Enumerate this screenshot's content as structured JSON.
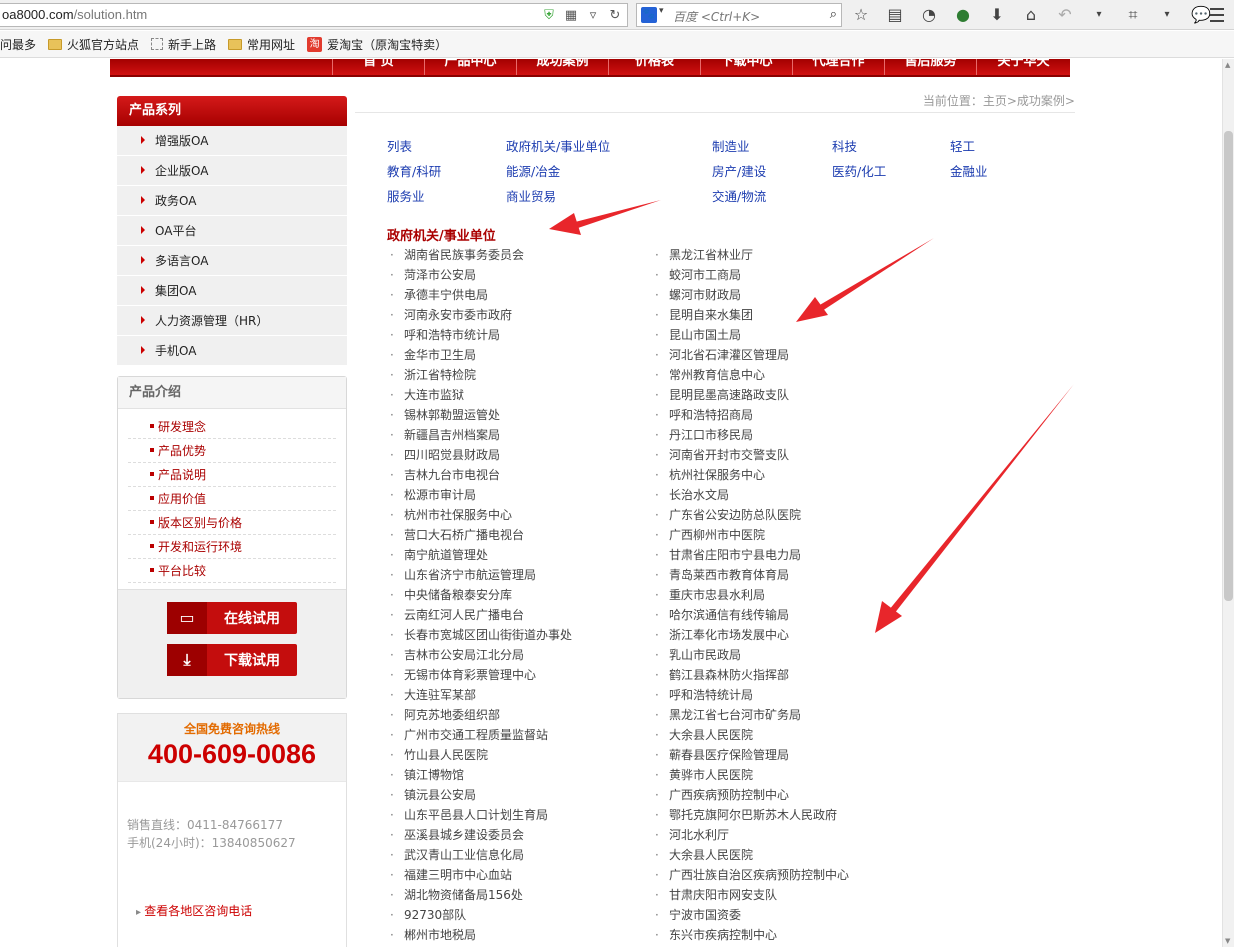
{
  "browser": {
    "url_host": "oa8000.com",
    "url_path": "/solution.htm",
    "search_placeholder": "百度 <Ctrl+K>",
    "search_engine_glyph": "🐾",
    "bookmarks": [
      {
        "label": "问最多",
        "type": "text"
      },
      {
        "label": "火狐官方站点",
        "type": "folder"
      },
      {
        "label": "新手上路",
        "type": "dashed"
      },
      {
        "label": "常用网址",
        "type": "folder"
      },
      {
        "label": "爱淘宝（原淘宝特卖）",
        "type": "taobao",
        "glyph": "淘"
      }
    ]
  },
  "nav": {
    "items": [
      "首 页",
      "产品中心",
      "成功案例",
      "价格表",
      "下载中心",
      "代理合作",
      "售后服务",
      "关于华天"
    ]
  },
  "sidebar": {
    "series_title": "产品系列",
    "products": [
      "增强版OA",
      "企业版OA",
      "政务OA",
      "OA平台",
      "多语言OA",
      "集团OA",
      "人力资源管理（HR）",
      "手机OA"
    ],
    "intro_title": "产品介绍",
    "intro_items": [
      "研发理念",
      "产品优势",
      "产品说明",
      "应用价值",
      "版本区别与价格",
      "开发和运行环境",
      "平台比较"
    ],
    "online_trial": "在线试用",
    "download_trial": "下载试用",
    "hotline_label": "全国免费咨询热线",
    "hotline_number": "400-609-0086",
    "sales_line": "销售直线：0411-84766177",
    "mobile_line": "手机(24小时)：13840850627",
    "region_link": "查看各地区咨询电话"
  },
  "content": {
    "breadcrumb": "当前位置：主页>成功案例>",
    "categories": [
      [
        "列表",
        "政府机关/事业单位",
        "制造业",
        "科技",
        "轻工"
      ],
      [
        "教育/科研",
        "能源/冶金",
        "房产/建设",
        "医药/化工",
        "金融业"
      ],
      [
        "服务业",
        "商业贸易",
        "交通/物流"
      ]
    ],
    "section_title": "政府机关/事业单位",
    "orgs_left": [
      "湖南省民族事务委员会",
      "菏泽市公安局",
      "承德丰宁供电局",
      "河南永安市委市政府",
      "呼和浩特市统计局",
      "金华市卫生局",
      "浙江省特检院",
      "大连市监狱",
      "锡林郭勒盟运管处",
      "新疆昌吉州档案局",
      "四川昭觉县财政局",
      "吉林九台市电视台",
      "松源市审计局",
      "杭州市社保服务中心",
      "营口大石桥广播电视台",
      "南宁航道管理处",
      "山东省济宁市航运管理局",
      "中央储备粮泰安分库",
      "云南红河人民广播电台",
      "长春市宽城区团山街街道办事处",
      "吉林市公安局江北分局",
      "无锡市体育彩票管理中心",
      "大连驻军某部",
      "阿克苏地委组织部",
      "广州市交通工程质量监督站",
      "竹山县人民医院",
      "镇江博物馆",
      "镇沅县公安局",
      "山东平邑县人口计划生育局",
      "巫溪县城乡建设委员会",
      "武汉青山工业信息化局",
      "福建三明市中心血站",
      "湖北物资储备局156处",
      "92730部队",
      "郴州市地税局"
    ],
    "orgs_right": [
      "黑龙江省林业厅",
      "蛟河市工商局",
      "螺河市财政局",
      "昆明自来水集团",
      "昆山市国土局",
      "河北省石津灌区管理局",
      "常州教育信息中心",
      "昆明昆墨高速路政支队",
      "呼和浩特招商局",
      "丹江口市移民局",
      "河南省开封市交警支队",
      "杭州社保服务中心",
      "长治水文局",
      "广东省公安边防总队医院",
      "广西柳州市中医院",
      "甘肃省庄阳市宁县电力局",
      "青岛莱西市教育体育局",
      "重庆市忠县水利局",
      "哈尔滨通信有线传输局",
      "浙江奉化市场发展中心",
      "乳山市民政局",
      "鹤江县森林防火指挥部",
      "呼和浩特统计局",
      "黑龙江省七台河市矿务局",
      "大余县人民医院",
      "蕲春县医疗保险管理局",
      "黄骅市人民医院",
      "广西疾病预防控制中心",
      "鄂托克旗阿尔巴斯苏木人民政府",
      "河北水利厅",
      "大余县人民医院",
      "广西壮族自治区疾病预防控制中心",
      "甘肃庆阳市网安支队",
      "宁波市国资委",
      "东兴市疾病控制中心"
    ]
  },
  "colors": {
    "brand_red": "#c40d0d",
    "link_blue": "#1d3db0",
    "hotline_orange": "#e36b00",
    "annotation_arrow": "#e8262b"
  }
}
